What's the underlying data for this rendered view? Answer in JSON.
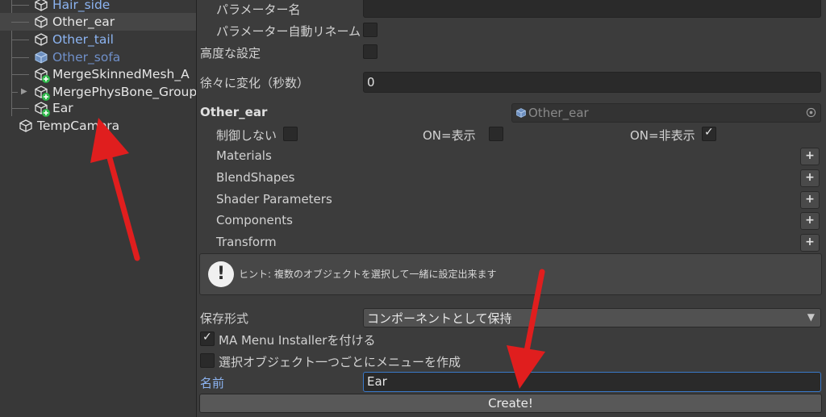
{
  "hierarchy": {
    "items": [
      {
        "label": "Hair_side"
      },
      {
        "label": "Other_ear"
      },
      {
        "label": "Other_tail"
      },
      {
        "label": "Other_sofa"
      },
      {
        "label": "MergeSkinnedMesh_A"
      },
      {
        "label": "MergePhysBone_Group"
      },
      {
        "label": "Ear"
      },
      {
        "label": "TempCamera"
      }
    ]
  },
  "inspector": {
    "param_name_label": "パラメーター名",
    "param_name_value": "",
    "param_auto_rename_label": "パラメーター自動リネーム",
    "advanced_label": "高度な設定",
    "gradual_label": "徐々に変化（秒数）",
    "gradual_value": "0",
    "object_label": "Other_ear",
    "object_ref": "Other_ear",
    "no_control_label": "制御しない",
    "on_show_label": "ON=表示",
    "on_hide_label": "ON=非表示",
    "sections": [
      {
        "label": "Materials"
      },
      {
        "label": "BlendShapes"
      },
      {
        "label": "Shader Parameters"
      },
      {
        "label": "Components"
      },
      {
        "label": "Transform"
      }
    ],
    "plus_symbol": "+",
    "hint_text": "ヒント: 複数のオブジェクトを選択して一緒に設定出来ます",
    "save_format_label": "保存形式",
    "save_format_value": "コンポーネントとして保持",
    "ma_installer_label": "MA Menu Installerを付ける",
    "per_object_menu_label": "選択オブジェクト一つごとにメニューを作成",
    "name_label": "名前",
    "name_value": "Ear",
    "create_label": "Create!"
  },
  "state": {
    "param_auto_rename": false,
    "advanced": false,
    "no_control": false,
    "on_show": false,
    "on_hide": true,
    "ma_installer": true,
    "per_object_menu": false
  },
  "colors": {
    "accent_blue": "#8cb4f2",
    "annotation_red": "#e01e1e",
    "badge_green": "#2fb84a"
  }
}
